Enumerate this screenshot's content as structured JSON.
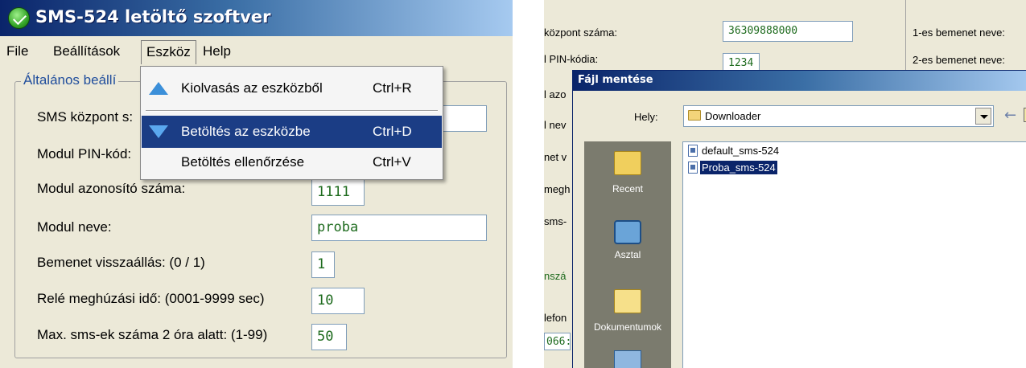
{
  "left": {
    "app_title": "SMS-524 letöltő szoftver",
    "menu": [
      "File",
      "Beállítások",
      "Eszköz",
      "Help"
    ],
    "group_title": "Általános beállí",
    "fields": [
      {
        "label": "SMS központ s:",
        "value": ""
      },
      {
        "label": "Modul PIN-kód:",
        "value": ""
      },
      {
        "label": "Modul azonosító száma:",
        "value": "1111"
      },
      {
        "label": "Modul neve:",
        "value": "proba"
      },
      {
        "label": "Bemenet visszaállás: (0 / 1)",
        "value": "1"
      },
      {
        "label": "Relé meghúzási idő: (0001-9999 sec)",
        "value": "10"
      },
      {
        "label": "Max. sms-ek száma 2 óra alatt: (1-99)",
        "value": "50"
      }
    ],
    "dropdown": [
      {
        "label": "Kiolvasás az eszközből",
        "shortcut": "Ctrl+R",
        "icon": "arrow-up-icon"
      },
      {
        "label": "Betöltés az eszközbe",
        "shortcut": "Ctrl+D",
        "icon": "arrow-down-icon",
        "highlighted": true
      },
      {
        "label": "Betöltés ellenőrzése",
        "shortcut": "Ctrl+V"
      }
    ]
  },
  "right": {
    "background_labels": [
      "központ száma:",
      "l PIN-kódia:",
      "l azo",
      "l nev",
      "net v",
      "megh",
      "sms-",
      "nszá",
      "lefon",
      "066:"
    ],
    "background_right_labels": [
      "1-es bemenet neve:",
      "2-es bemenet neve:"
    ],
    "background_values": [
      "36309888000",
      "1234"
    ],
    "dialog": {
      "title": "Fájl mentése",
      "location_label": "Hely:",
      "location_value": "Downloader",
      "places": [
        "Recent",
        "Asztal",
        "Dokumentumok"
      ],
      "files": [
        {
          "name": "default_sms-524",
          "selected": false
        },
        {
          "name": "Proba_sms-524",
          "selected": true
        }
      ]
    }
  }
}
